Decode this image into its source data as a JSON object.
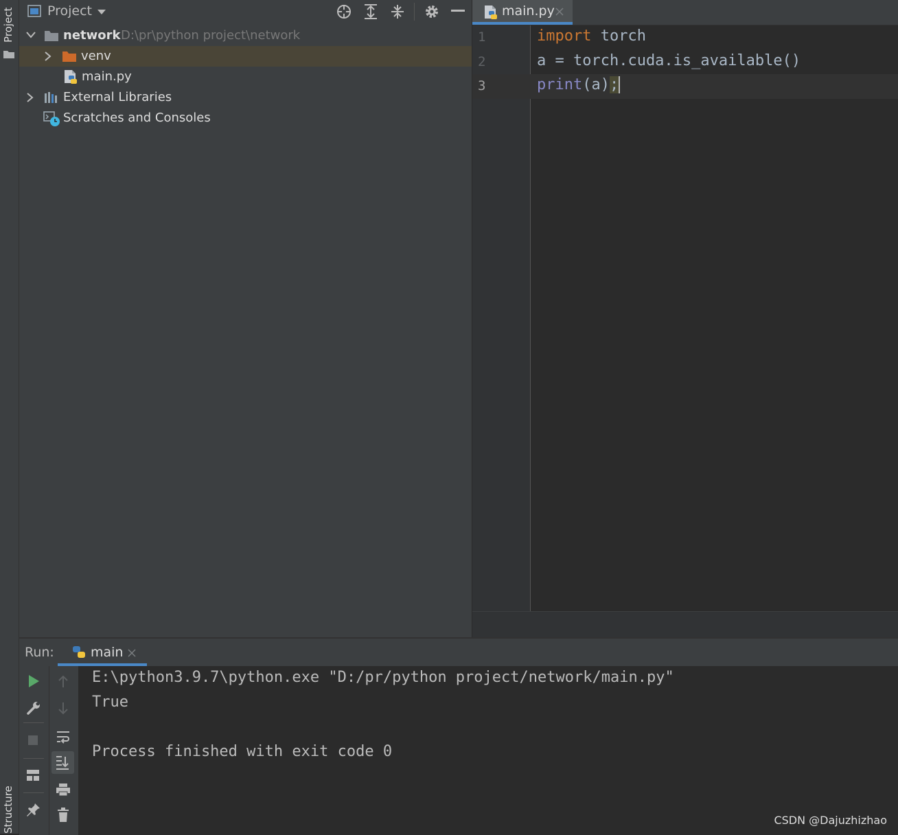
{
  "left_strip": {
    "project_label": "Project",
    "structure_label": "Structure"
  },
  "project_panel": {
    "title": "Project",
    "tree": [
      {
        "name": "network",
        "path": "D:\\pr\\python project\\network",
        "kind": "folder",
        "expanded": true
      },
      {
        "name": "venv",
        "kind": "excluded-folder",
        "expanded": false,
        "selected": true
      },
      {
        "name": "main.py",
        "kind": "python-file"
      },
      {
        "name": "External Libraries",
        "kind": "libraries",
        "expanded": false
      },
      {
        "name": "Scratches and Consoles",
        "kind": "scratches"
      }
    ]
  },
  "editor": {
    "tab": {
      "label": "main.py"
    },
    "lines": [
      {
        "number": "1",
        "tokens": [
          {
            "text": "import",
            "style": "keyword"
          },
          {
            "text": " torch",
            "style": "plain"
          }
        ]
      },
      {
        "number": "2",
        "tokens": [
          {
            "text": "a = torch.cuda.is_available()",
            "style": "plain"
          }
        ]
      },
      {
        "number": "3",
        "tokens": [
          {
            "text": "print",
            "style": "builtin"
          },
          {
            "text": "(a)",
            "style": "plain"
          },
          {
            "text": ";",
            "style": "warn"
          }
        ]
      }
    ]
  },
  "run_panel": {
    "label": "Run:",
    "tab_label": "main",
    "console": [
      "E:\\python3.9.7\\python.exe \"D:/pr/python project/network/main.py\"",
      "True",
      "",
      "Process finished with exit code 0"
    ]
  },
  "watermark": "CSDN @Dajuzhizhao",
  "colors": {
    "keyword": "#cc7832",
    "builtin": "#8888c6",
    "plain": "#a9b7c6",
    "selection": "#4a4537",
    "tab_accent": "#4a88c7",
    "folder": "#8a8f95",
    "excluded_folder": "#cd6a2a",
    "run_green": "#59a869"
  }
}
